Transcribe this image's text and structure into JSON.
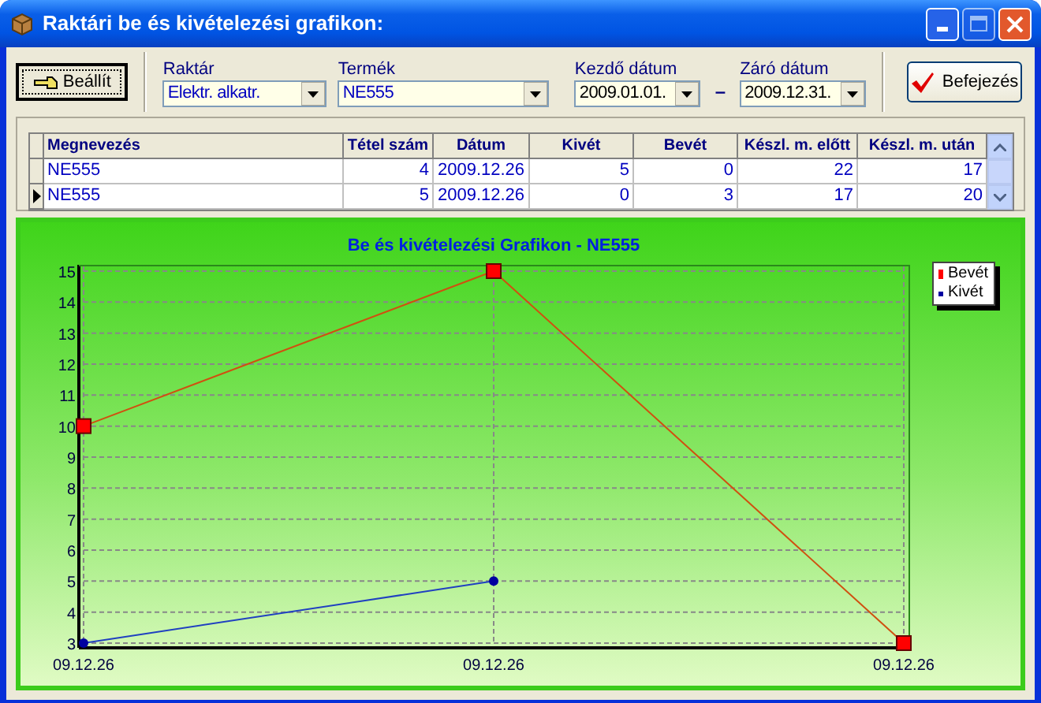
{
  "window": {
    "title": "Raktári be és kivételezési grafikon:"
  },
  "toolbar": {
    "apply_button": "Beállít",
    "finish_button": "Befejezés",
    "date_separator": "–",
    "fields": [
      {
        "label": "Raktár",
        "value": "Elektr. alkatr."
      },
      {
        "label": "Termék",
        "value": "NE555"
      },
      {
        "label": "Kezdő dátum",
        "value": "2009.01.01."
      },
      {
        "label": "Záró dátum",
        "value": "2009.12.31."
      }
    ]
  },
  "table": {
    "columns": [
      "Megnevezés",
      "Tétel szám",
      "Dátum",
      "Kivét",
      "Bevét",
      "Készl. m. előtt",
      "Készl. m. után"
    ],
    "rows": [
      {
        "selected": false,
        "cells": [
          "NE555",
          "4",
          "2009.12.26",
          "5",
          "0",
          "22",
          "17"
        ]
      },
      {
        "selected": true,
        "cells": [
          "NE555",
          "5",
          "2009.12.26",
          "0",
          "3",
          "17",
          "20"
        ]
      }
    ]
  },
  "chart": {
    "chart_data": {
      "type": "line",
      "title": "Be és kivételezési Grafikon - NE555",
      "categories": [
        "09.12.26",
        "09.12.26",
        "09.12.26"
      ],
      "series": [
        {
          "name": "Bevét",
          "color": "#ff0000",
          "marker": "square",
          "values": [
            10,
            15,
            3
          ]
        },
        {
          "name": "Kivét",
          "color": "#0000a0",
          "marker": "circle",
          "values": [
            3,
            5,
            null
          ]
        }
      ],
      "grid": true,
      "legend": true,
      "ylim": [
        3,
        15
      ],
      "yticks": [
        3,
        4,
        5,
        6,
        7,
        8,
        9,
        10,
        11,
        12,
        13,
        14,
        15
      ]
    }
  }
}
